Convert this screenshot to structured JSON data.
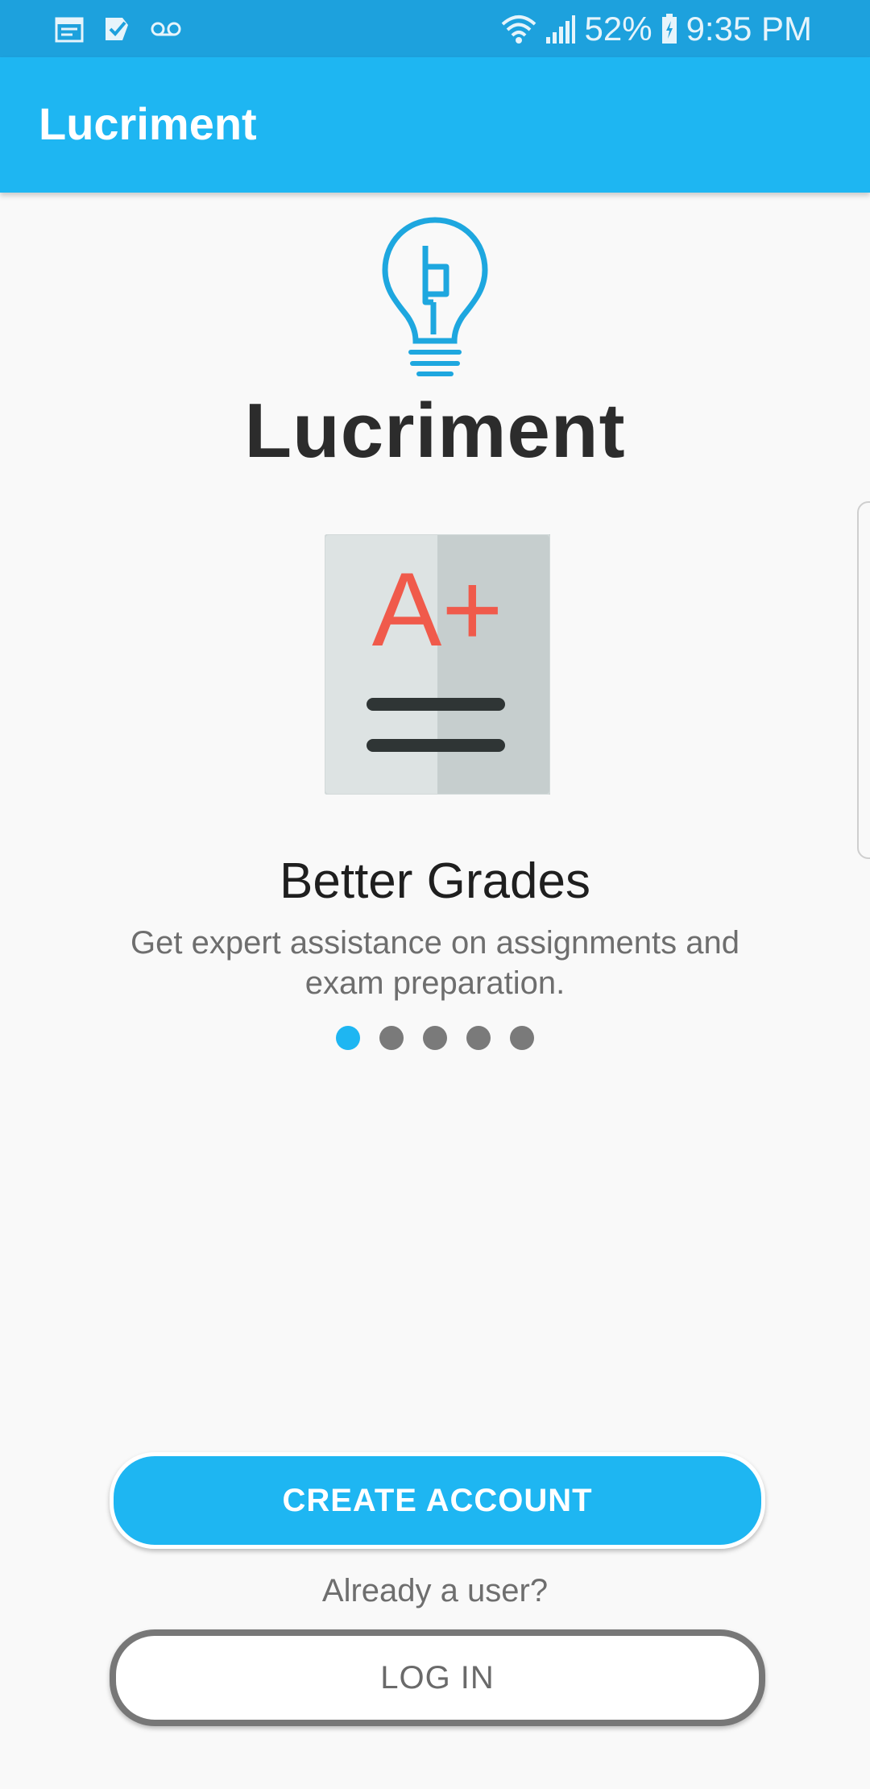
{
  "status_bar": {
    "battery": "52%",
    "time": "9:35 PM",
    "icons": [
      "calendar-icon",
      "task-check-icon",
      "voicemail-icon",
      "wifi-icon",
      "signal-icon",
      "battery-charging-icon"
    ]
  },
  "app_bar": {
    "title": "Lucriment"
  },
  "logo": {
    "wordmark": "Lucriment",
    "icon": "lightbulb-logo-icon"
  },
  "slide": {
    "illustration_text": "A+",
    "title": "Better Grades",
    "description": "Get expert assistance on assignments and exam preparation.",
    "page_count": 5,
    "active_page": 1
  },
  "actions": {
    "create_account": "CREATE ACCOUNT",
    "already_user": "Already a user?",
    "log_in": "LOG IN"
  },
  "colors": {
    "status_bar": "#1da1dd",
    "primary": "#1eb6f2",
    "grade": "#f05a4b",
    "dark": "#2c2c2c",
    "background": "#f9f9f9"
  }
}
